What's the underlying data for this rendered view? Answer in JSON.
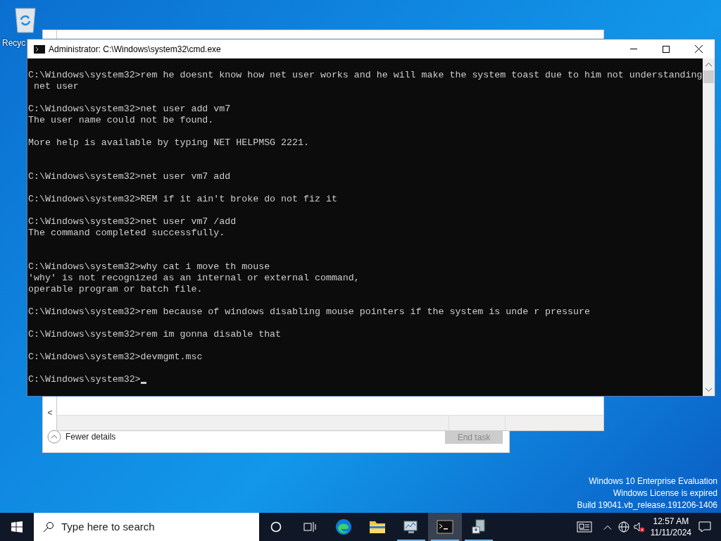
{
  "desktop": {
    "icons": [
      {
        "label": "Recyc"
      }
    ]
  },
  "background_window": {
    "details_toggle": "Fewer details",
    "end_task": {
      "label": "End task",
      "disabled": true
    },
    "scroll_left": "<"
  },
  "console_window": {
    "title": "Administrator: C:\\Windows\\system32\\cmd.exe",
    "lines": [
      {
        "kind": "blank"
      },
      {
        "kind": "text",
        "text": "C:\\Windows\\system32>rem he doesnt know how net user works and he will make the system toast due to him not understanding"
      },
      {
        "kind": "text",
        "text": " net user"
      },
      {
        "kind": "blank"
      },
      {
        "kind": "text",
        "text": "C:\\Windows\\system32>net user add vm7"
      },
      {
        "kind": "text",
        "text": "The user name could not be found."
      },
      {
        "kind": "blank"
      },
      {
        "kind": "text",
        "text": "More help is available by typing NET HELPMSG 2221."
      },
      {
        "kind": "blank"
      },
      {
        "kind": "blank"
      },
      {
        "kind": "text",
        "text": "C:\\Windows\\system32>net user vm7 add"
      },
      {
        "kind": "blank"
      },
      {
        "kind": "text",
        "text": "C:\\Windows\\system32>REM if it ain't broke do not fiz it"
      },
      {
        "kind": "blank"
      },
      {
        "kind": "text",
        "text": "C:\\Windows\\system32>net user vm7 /add"
      },
      {
        "kind": "text",
        "text": "The command completed successfully."
      },
      {
        "kind": "blank"
      },
      {
        "kind": "blank"
      },
      {
        "kind": "text",
        "text": "C:\\Windows\\system32>why cat i move th mouse"
      },
      {
        "kind": "text",
        "text": "'why' is not recognized as an internal or external command,"
      },
      {
        "kind": "text",
        "text": "operable program or batch file."
      },
      {
        "kind": "blank"
      },
      {
        "kind": "text",
        "text": "C:\\Windows\\system32>rem because of windows disabling mouse pointers if the system is unde r pressure"
      },
      {
        "kind": "blank"
      },
      {
        "kind": "text",
        "text": "C:\\Windows\\system32>rem im gonna disable that"
      },
      {
        "kind": "blank"
      },
      {
        "kind": "text",
        "text": "C:\\Windows\\system32>devmgmt.msc"
      },
      {
        "kind": "blank"
      },
      {
        "kind": "prompt",
        "text": "C:\\Windows\\system32>"
      }
    ]
  },
  "watermark_notice": [
    "Windows 10 Enterprise Evaluation",
    "Windows License is expired",
    "Build 19041.vb_release.191206-1406"
  ],
  "taskbar": {
    "search": {
      "placeholder": "Type here to search"
    },
    "apps": [
      {
        "kind": "edge",
        "running": false,
        "selected": false
      },
      {
        "kind": "folder",
        "running": false,
        "selected": false
      },
      {
        "kind": "monitor",
        "running": true,
        "selected": false
      },
      {
        "kind": "console",
        "running": true,
        "selected": true
      },
      {
        "kind": "setup",
        "running": true,
        "selected": false
      }
    ],
    "clock": {
      "time": "12:57 AM",
      "date": "11/11/2024"
    }
  }
}
